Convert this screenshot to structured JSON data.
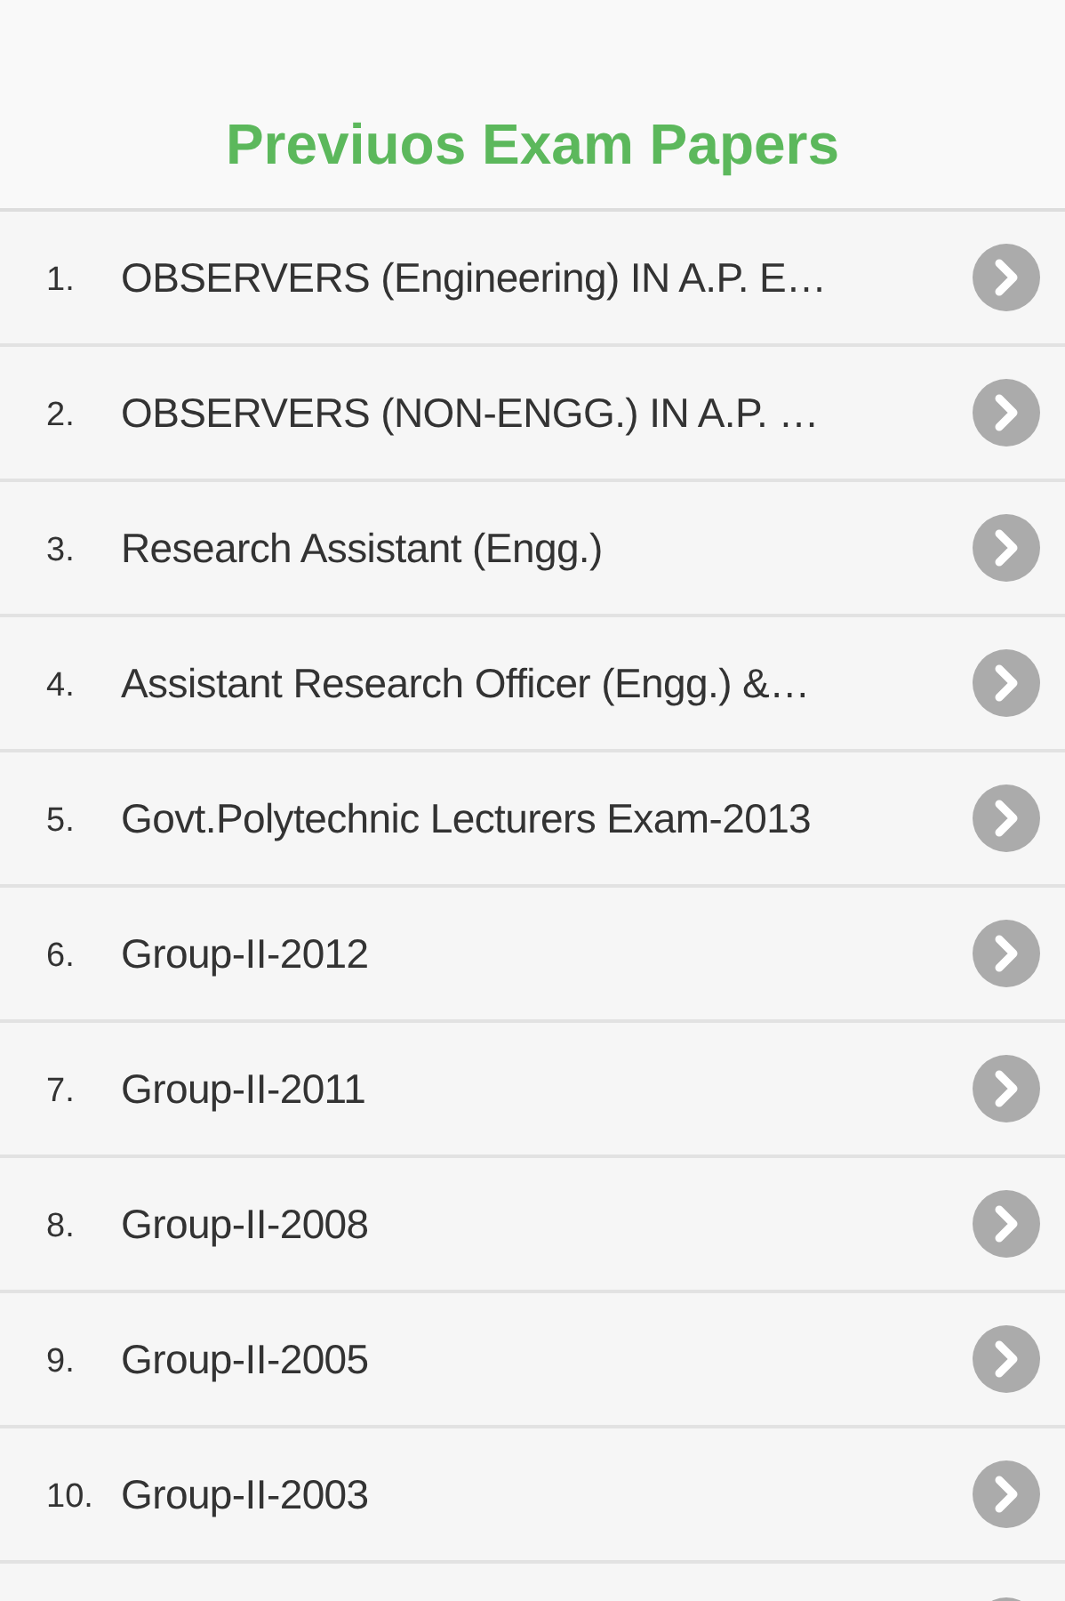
{
  "header": {
    "title": "Previuos Exam Papers"
  },
  "items": [
    {
      "number": "1.",
      "label": "OBSERVERS (Engineering) IN A.P. E…"
    },
    {
      "number": "2.",
      "label": "OBSERVERS (NON-ENGG.) IN A.P. …"
    },
    {
      "number": "3.",
      "label": "Research Assistant (Engg.)"
    },
    {
      "number": "4.",
      "label": "Assistant Research Officer (Engg.) &…"
    },
    {
      "number": "5.",
      "label": "Govt.Polytechnic Lecturers Exam-2013"
    },
    {
      "number": "6.",
      "label": "Group-II-2012"
    },
    {
      "number": "7.",
      "label": "Group-II-2011"
    },
    {
      "number": "8.",
      "label": "Group-II-2008"
    },
    {
      "number": "9.",
      "label": "Group-II-2005"
    },
    {
      "number": "10.",
      "label": "Group-II-2003"
    }
  ]
}
